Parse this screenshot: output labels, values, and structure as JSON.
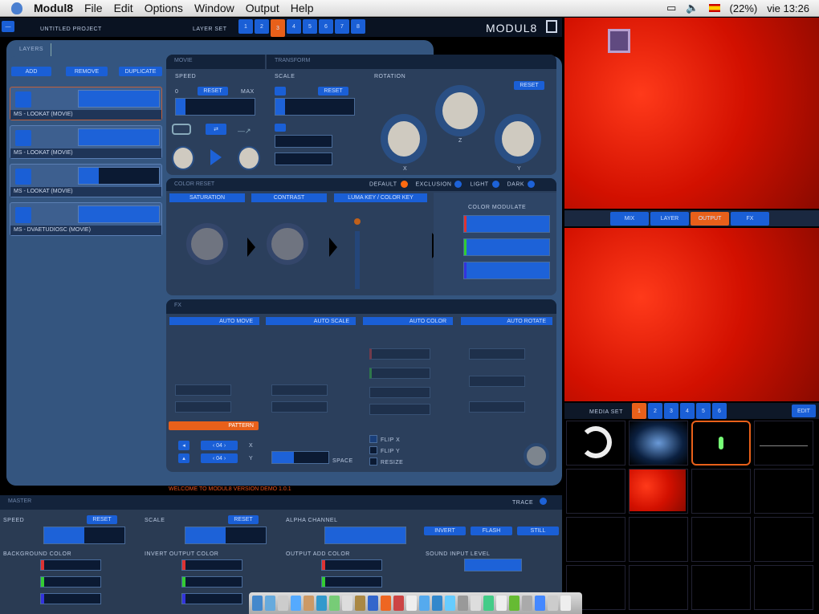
{
  "menubar": {
    "app": "Modul8",
    "items": [
      "File",
      "Edit",
      "Options",
      "Window",
      "Output",
      "Help"
    ],
    "battery": "(22%)",
    "clock": "vie 13:26"
  },
  "top": {
    "project": "UNTITLED PROJECT",
    "layer_set_label": "LAYER SET",
    "layer_sets": [
      "1",
      "2",
      "3",
      "4",
      "5",
      "6",
      "7",
      "8"
    ],
    "active_set": "3",
    "logo": "MODUL8"
  },
  "layers_tab": "LAYERS",
  "layer_buttons": {
    "add": "ADD",
    "remove": "REMOVE",
    "duplicate": "DUPLICATE"
  },
  "layers": [
    {
      "name": "MS - LOOKAT (MOVIE)",
      "fill": 1.0
    },
    {
      "name": "MS - LOOKAT (MOVIE)",
      "fill": 1.0
    },
    {
      "name": "MS - LOOKAT (MOVIE)",
      "fill": 0.25
    },
    {
      "name": "MS - DVAETUDIOSC (MOVIE)",
      "fill": 1.0
    }
  ],
  "movie": {
    "title": "MOVIE",
    "speed": "SPEED",
    "reset": "RESET",
    "min": "0",
    "max": "MAX",
    "speed_value": 0.12
  },
  "transform": {
    "title": "TRANSFORM",
    "scale": "SCALE",
    "reset": "RESET",
    "scale_value": 0.12,
    "rotation": "ROTATION",
    "rot_reset": "RESET",
    "x": "X",
    "y": "Y",
    "z": "Z"
  },
  "color": {
    "title": "COLOR RESET",
    "modes": [
      {
        "label": "DEFAULT",
        "on": true
      },
      {
        "label": "EXCLUSION"
      },
      {
        "label": "LIGHT"
      },
      {
        "label": "DARK"
      }
    ],
    "saturation": "SATURATION",
    "contrast": "CONTRAST",
    "lumakey": "LUMA KEY / COLOR KEY",
    "modulate": "COLOR MODULATE"
  },
  "fx": {
    "title": "FX",
    "auto_move": "AUTO MOVE",
    "auto_scale": "AUTO SCALE",
    "auto_color": "AUTO COLOR",
    "auto_rotate": "AUTO ROTATE",
    "pattern": "PATTERN",
    "space": "SPACE",
    "flip_x": "FLIP X",
    "flip_y": "FLIP Y",
    "resize": "RESIZE",
    "x": "X",
    "y": "Y"
  },
  "status": "WELCOME TO MODUL8 VERSION DEMO 1.0.1",
  "master": {
    "title": "MASTER",
    "trace": "TRACE",
    "speed": "SPEED",
    "scale": "SCALE",
    "reset": "RESET",
    "alpha": "ALPHA CHANNEL",
    "invert": "INVERT",
    "flash": "FLASH",
    "still": "STILL",
    "bg_color": "BACKGROUND COLOR",
    "invert_output": "INVERT OUTPUT COLOR",
    "output_add": "OUTPUT ADD COLOR",
    "sound": "SOUND INPUT LEVEL",
    "speed_value": 0.5,
    "scale_value": 0.5
  },
  "preview": {
    "tabs": [
      "MIX",
      "LAYER",
      "OUTPUT",
      "FX"
    ],
    "active": "OUTPUT"
  },
  "media": {
    "label": "MEDIA SET",
    "sets": [
      "1",
      "2",
      "3",
      "4",
      "5",
      "6"
    ],
    "active": "1",
    "edit": "EDIT"
  }
}
